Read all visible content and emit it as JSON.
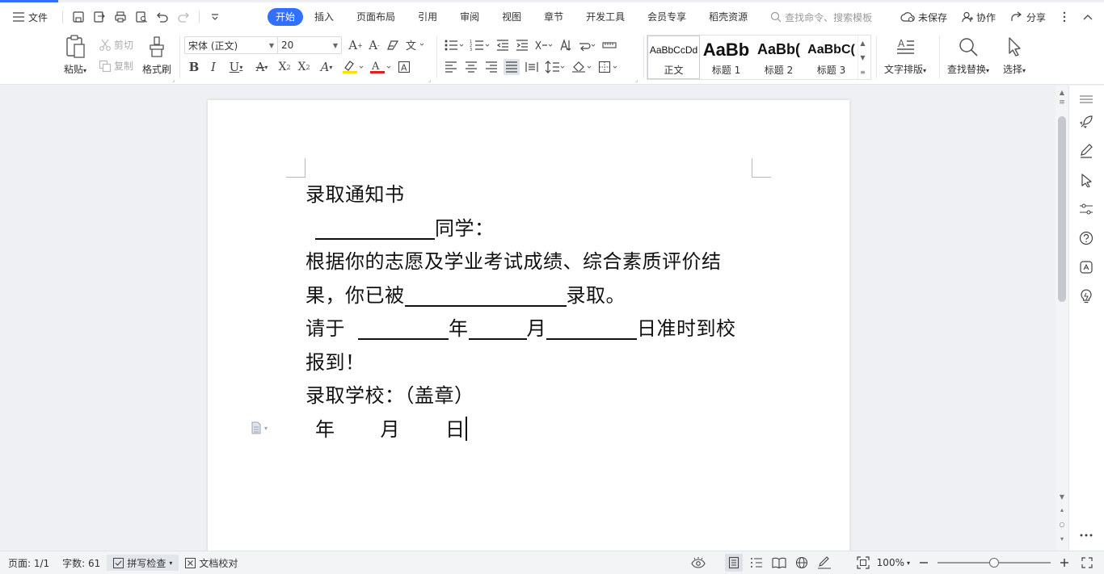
{
  "menubar": {
    "file_label": "文件",
    "tabs": [
      {
        "label": "开始",
        "active": true
      },
      {
        "label": "插入"
      },
      {
        "label": "页面布局"
      },
      {
        "label": "引用"
      },
      {
        "label": "审阅"
      },
      {
        "label": "视图"
      },
      {
        "label": "章节"
      },
      {
        "label": "开发工具"
      },
      {
        "label": "会员专享"
      },
      {
        "label": "稻壳资源"
      }
    ],
    "search_placeholder": "查找命令、搜索模板",
    "unsaved_label": "未保存",
    "collab_label": "协作",
    "share_label": "分享"
  },
  "ribbon": {
    "paste_label": "粘贴",
    "cut_label": "剪切",
    "copy_label": "复制",
    "format_painter_label": "格式刷",
    "font_name": "宋体 (正文)",
    "font_size": "20",
    "styles": [
      {
        "preview": "AaBbCcDd",
        "label": "正文"
      },
      {
        "preview": "AaBb",
        "label": "标题 1"
      },
      {
        "preview": "AaBb(",
        "label": "标题 2"
      },
      {
        "preview": "AaBbC(",
        "label": "标题 3"
      }
    ],
    "text_layout_label": "文字排版",
    "find_replace_label": "查找替换",
    "select_label": "选择"
  },
  "document": {
    "line1": "录取通知书",
    "line2_suffix": "同学：",
    "line3": "根据你的志愿及学业考试成绩、综合素质评价结",
    "line4_prefix": "果，你已被",
    "line4_suffix": "录取。",
    "line5_prefix": "请于",
    "line5_year": "年",
    "line5_month": "月",
    "line5_day": "日准时到校",
    "line6": "报到！",
    "line7": "录取学校：（盖章）",
    "line8_year": "年",
    "line8_month": "月",
    "line8_day": "日"
  },
  "statusbar": {
    "page": "页面: 1/1",
    "word_count": "字数: 61",
    "spell_check": "拼写检查",
    "doc_proof": "文档校对",
    "zoom": "100%",
    "zoom_fraction": 0.5
  },
  "colors": {
    "accent": "#3370ff"
  }
}
